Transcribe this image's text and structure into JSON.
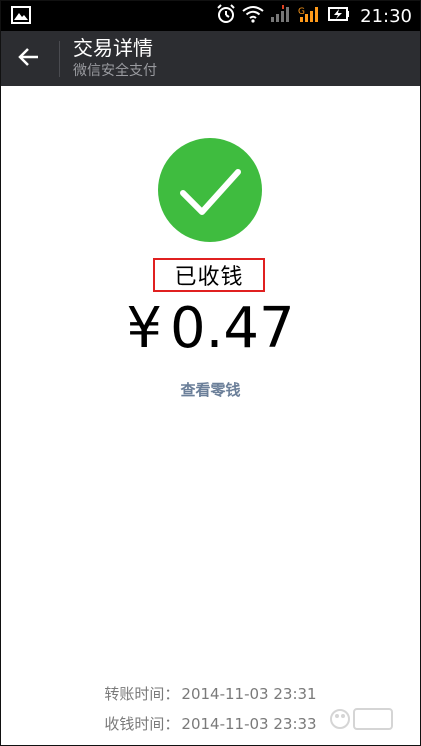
{
  "status_bar": {
    "time": "21:30",
    "icons": [
      "image-icon",
      "alarm-icon",
      "wifi-icon",
      "signal-icon",
      "signal-g-icon",
      "battery-icon"
    ]
  },
  "header": {
    "title": "交易详情",
    "subtitle": "微信安全支付",
    "back_icon": "back-arrow-icon"
  },
  "transaction": {
    "status_icon": "check-circle-icon",
    "status_color": "#3fbc3f",
    "status_text": "已收钱",
    "currency_symbol": "¥",
    "amount": "0.47",
    "view_change_label": "查看零钱"
  },
  "details": {
    "transfer_time_label": "转账时间：",
    "transfer_time_value": "2014-11-03 23:31",
    "receive_time_label": "收钱时间：",
    "receive_time_value": "2014-11-03 23:33"
  },
  "colors": {
    "header_bg": "#2c2d31",
    "link": "#6b7f99",
    "highlight_border": "#e02020"
  }
}
